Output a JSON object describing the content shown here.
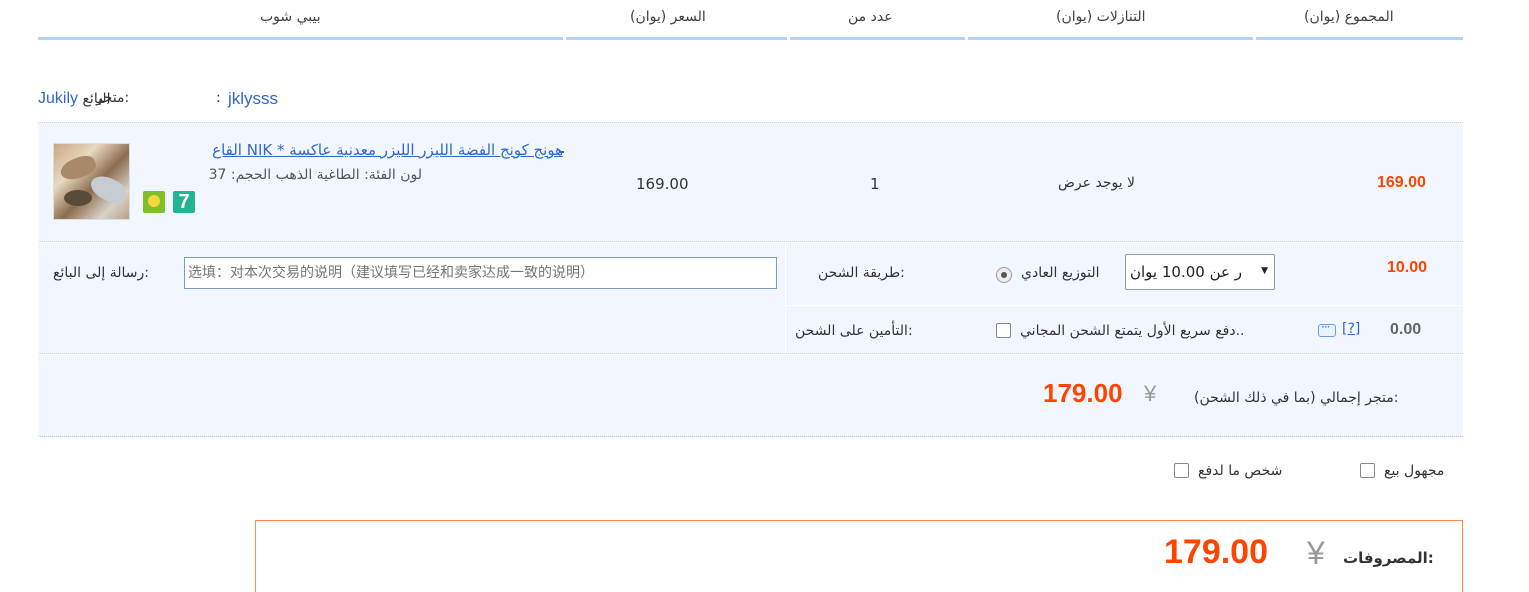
{
  "header": {
    "col_item": "بيبي شوب",
    "col_price": "(السعر (يوان",
    "col_qty": "عدد من",
    "col_discount": "(التنازلات (يوان",
    "col_total": "(المجموع (يوان"
  },
  "seller": {
    "seller_label": "البائع",
    "seller_name": "Jukily",
    "store_label": "متجر:",
    "colon": ":",
    "store_name": "jklysss"
  },
  "item": {
    "title": "هونج كونج الفضة الليزر الليزر معدنية عاكسة * NIK القاع",
    "properties": "لون الفئة: الطاغية الذهب   الحجم: 37",
    "badge_icons": [
      "consumer-protection-icon",
      "seven-day-return-icon"
    ],
    "badge_seven": "7",
    "price": "169.00",
    "quantity": "1",
    "promotion": "لا يوجد عرض",
    "subtotal": "169.00"
  },
  "options": {
    "message_label": "رسالة إلى البائع:",
    "message_placeholder": "选填：对本次交易的说明（建议填写已经和卖家达成一致的说明）",
    "shipping_label": "طريقة الشحن:",
    "shipping_option": "التوزيع العادي",
    "shipping_select_value": "ر عن 10.00 يوان",
    "shipping_fee": "10.00",
    "insurance_label": "التأمين على الشحن:",
    "insurance_text": "دفع سريع الأول يتمتع الشحن المجاني..",
    "insurance_help": "[?]",
    "insurance_fee": "0.00"
  },
  "store_total": {
    "label": "متجر إجمالي (بما في ذلك الشحن):",
    "currency": "¥",
    "amount": "179.00"
  },
  "checkout_options": {
    "anonymous_label": "مجهول بيع",
    "pay_for_me_label": "شخص ما لدفع"
  },
  "grand_total": {
    "label": "المصروفات:",
    "currency": "¥",
    "amount": "179.00"
  },
  "colors": {
    "accent_orange": "#ff4400",
    "link_blue": "#3366cc",
    "row_bg": "#f2f7ff",
    "header_line": "#b2d1ff"
  }
}
